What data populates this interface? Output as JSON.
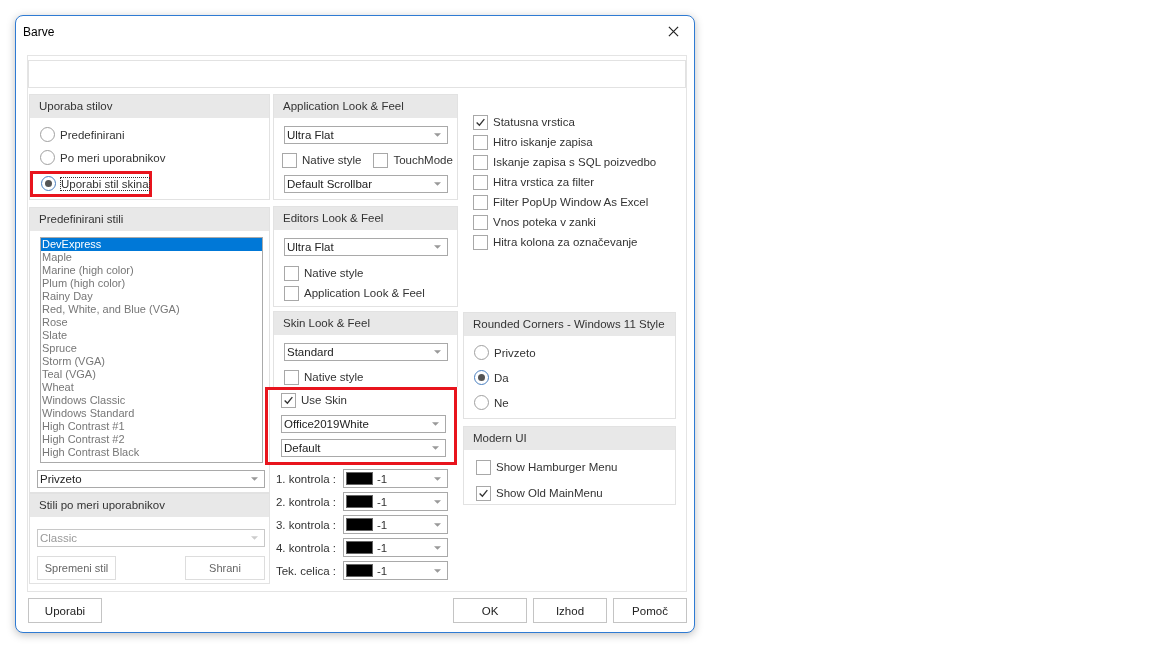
{
  "window": {
    "title": "Barve"
  },
  "style_usage": {
    "title": "Uporaba stilov",
    "options": [
      {
        "label": "Predefinirani",
        "selected": false,
        "highlighted": false
      },
      {
        "label": "Po meri uporabnikov",
        "selected": false,
        "highlighted": false
      },
      {
        "label": "Uporabi stil skina",
        "selected": true,
        "highlighted": true
      }
    ]
  },
  "predefined_styles": {
    "title": "Predefinirani stili",
    "items": [
      {
        "label": "DevExpress",
        "selected": true
      },
      {
        "label": "Maple",
        "selected": false
      },
      {
        "label": "Marine (high color)",
        "selected": false
      },
      {
        "label": "Plum (high color)",
        "selected": false
      },
      {
        "label": "Rainy Day",
        "selected": false
      },
      {
        "label": "Red, White, and Blue (VGA)",
        "selected": false
      },
      {
        "label": "Rose",
        "selected": false
      },
      {
        "label": "Slate",
        "selected": false
      },
      {
        "label": "Spruce",
        "selected": false
      },
      {
        "label": "Storm (VGA)",
        "selected": false
      },
      {
        "label": "Teal (VGA)",
        "selected": false
      },
      {
        "label": "Wheat",
        "selected": false
      },
      {
        "label": "Windows Classic",
        "selected": false
      },
      {
        "label": "Windows Standard",
        "selected": false
      },
      {
        "label": "High Contrast #1",
        "selected": false
      },
      {
        "label": "High Contrast #2",
        "selected": false
      },
      {
        "label": "High Contrast Black",
        "selected": false
      }
    ],
    "dropdown": {
      "value": "Privzeto",
      "disabled": false
    }
  },
  "custom_styles": {
    "title": "Stili po meri uporabnikov",
    "dropdown": {
      "value": "Classic",
      "disabled": true
    },
    "buttons": [
      "Spremeni stil",
      "Shrani"
    ]
  },
  "app_look": {
    "title": "Application Look & Feel",
    "dropdown": "Ultra Flat",
    "checkboxes": [
      {
        "label": "Native style",
        "checked": false
      },
      {
        "label": "TouchMode",
        "checked": false
      }
    ],
    "scrollbar": "Default Scrollbar"
  },
  "editors_look": {
    "title": "Editors Look & Feel",
    "dropdown": "Ultra Flat",
    "checkboxes": [
      {
        "label": "Native style",
        "checked": false
      },
      {
        "label": "Application Look & Feel",
        "checked": false
      }
    ]
  },
  "skin_look": {
    "title": "Skin Look & Feel",
    "dropdown": "Standard",
    "native_style": {
      "label": "Native style",
      "checked": false
    },
    "use_skin": {
      "label": "Use Skin",
      "checked": true
    },
    "highlighted": true,
    "skin": "Office2019White",
    "palette": "Default"
  },
  "color_controls": [
    {
      "label": "1. kontrola :",
      "color": "#000000",
      "value": "-1"
    },
    {
      "label": "2. kontrola :",
      "color": "#000000",
      "value": "-1"
    },
    {
      "label": "3. kontrola :",
      "color": "#000000",
      "value": "-1"
    },
    {
      "label": "4. kontrola :",
      "color": "#000000",
      "value": "-1"
    },
    {
      "label": "Tek. celica :",
      "color": "#000000",
      "value": "-1"
    }
  ],
  "options": [
    {
      "label": "Statusna vrstica",
      "checked": true
    },
    {
      "label": "Hitro iskanje zapisa",
      "checked": false
    },
    {
      "label": "Iskanje zapisa s SQL poizvedbo",
      "checked": false
    },
    {
      "label": "Hitra vrstica za filter",
      "checked": false
    },
    {
      "label": "Filter PopUp Window As Excel",
      "checked": false
    },
    {
      "label": "Vnos poteka v zanki",
      "checked": false
    },
    {
      "label": "Hitra kolona za označevanje",
      "checked": false
    }
  ],
  "rounded_corners": {
    "title": "Rounded Corners - Windows 11 Style",
    "options": [
      {
        "label": "Privzeto",
        "selected": false
      },
      {
        "label": "Da",
        "selected": true
      },
      {
        "label": "Ne",
        "selected": false
      }
    ]
  },
  "modern_ui": {
    "title": "Modern UI",
    "checkboxes": [
      {
        "label": "Show Hamburger Menu",
        "checked": false
      },
      {
        "label": "Show Old MainMenu",
        "checked": true
      }
    ]
  },
  "buttons_left": [
    "Uporabi"
  ],
  "buttons_right": [
    "OK",
    "Izhod",
    "Pomoč"
  ]
}
